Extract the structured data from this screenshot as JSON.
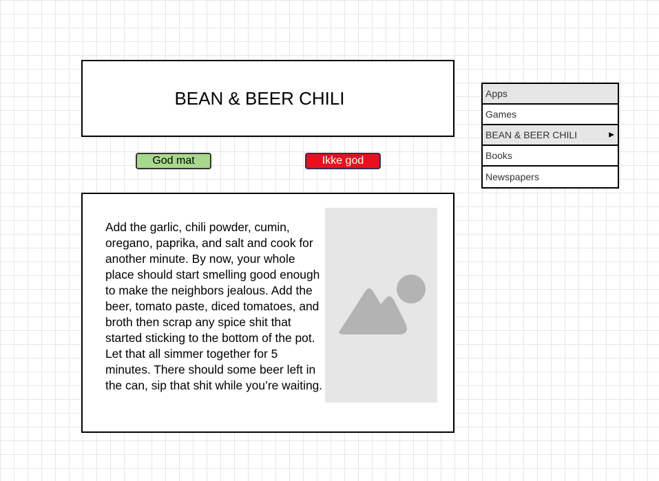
{
  "header": {
    "title": "BEAN & BEER CHILI"
  },
  "buttons": {
    "good_label": "God mat",
    "bad_label": "Ikke god"
  },
  "content": {
    "body": "Add the garlic, chili powder, cumin, oregano, paprika, and salt and cook for another minute. By now, your whole place should start smelling good enough to make the neighbors jealous. Add the beer, tomato paste, diced tomatoes, and broth then scrap any spice shit that started sticking to the bottom of the pot. Let that all simmer together for 5 minutes. There should some beer left in the can, sip that shit while you’re waiting."
  },
  "menu": {
    "items": [
      {
        "label": "Apps",
        "shaded": true
      },
      {
        "label": "Games",
        "shaded": false
      },
      {
        "label": "BEAN & BEER CHILI",
        "shaded": true,
        "submenu": true
      },
      {
        "label": "Books",
        "shaded": false
      },
      {
        "label": "Newspapers",
        "shaded": false
      }
    ]
  },
  "colors": {
    "good_button": "#a7d98c",
    "bad_button": "#e8101a",
    "placeholder_bg": "#e6e6e6",
    "placeholder_shape": "#b3b3b3"
  },
  "icons": {
    "image_placeholder": "image-icon",
    "submenu_arrow": "triangle-right-icon"
  }
}
